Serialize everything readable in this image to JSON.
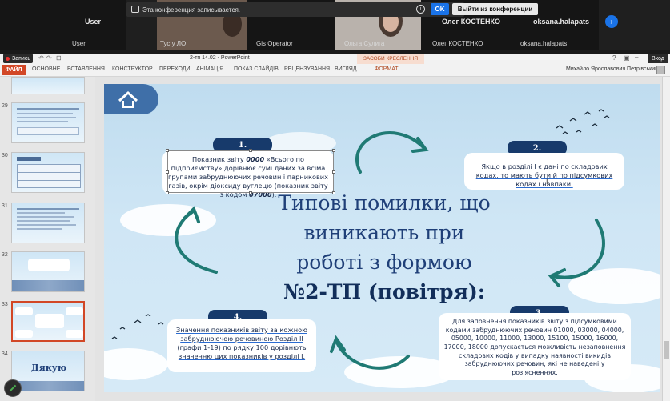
{
  "conference": {
    "recording_notice": "Эта конференция записывается.",
    "ok_label": "OK",
    "leave_label": "Выйти из конференции",
    "participants": [
      {
        "name": "User",
        "big_name": "User"
      },
      {
        "name": "Тус у ЛО"
      },
      {
        "name": "Gis Operator"
      },
      {
        "name": "Ольга Сулига"
      },
      {
        "name": "Олег КОСТЕНКО",
        "big_name": "Олег КОСТЕНКО"
      },
      {
        "name": "oksana.halapats",
        "big_name": "oksana.halapats"
      }
    ]
  },
  "powerpoint": {
    "window_title": "2-тп 14.02 - PowerPoint",
    "contextual_tab": "ЗАСОБИ КРЕСЛЕННЯ",
    "rec_label": "Запись",
    "enter_label": "Вход",
    "user_name": "Михайло Ярославович Петрівський",
    "tabs": [
      "ФАЙЛ",
      "ОСНОВНЕ",
      "ВСТАВЛЕННЯ",
      "КОНСТРУКТОР",
      "ПЕРЕХОДИ",
      "АНІМАЦІЯ",
      "ПОКАЗ СЛАЙДІВ",
      "РЕЦЕНЗУВАННЯ",
      "ВИГЛЯД",
      "ФОРМАТ"
    ],
    "thumbnails": [
      {
        "num": "29"
      },
      {
        "num": "30"
      },
      {
        "num": "31"
      },
      {
        "num": "32"
      },
      {
        "num": "33",
        "selected": true
      },
      {
        "num": "34",
        "text": "Дякую"
      }
    ]
  },
  "slide": {
    "title_lines": [
      "Типові помилки, що",
      "виникають при",
      "роботі з формою"
    ],
    "title_bold": "№2-ТП (повітря):",
    "box1": {
      "badge": "1.",
      "text_a": "Показник звіту ",
      "text_b": "0000",
      "text_c": " «Всього по підприємству» дорівнює сумі даних за всіма групами забруднюючих речовин і парникових газів, окрім діоксиду вуглецю (показник звіту з кодом ",
      "text_d": "07000",
      "text_e": ")."
    },
    "box2": {
      "badge": "2.",
      "text": "Якщо в розділі І є дані по складових кодах, то мають бути й по підсумкових кодах і навпаки."
    },
    "box3": {
      "badge": "3.",
      "text_a": "Для заповнення показників звіту з підсумковими кодами забруднюючих речовин 01000, 03000, 04000, 05000, 10000, 11000, 13000, 15100, 15000, 16000, 17000, 18000",
      "text_b": " допускається можливість незаповнення складових кодів у випадку наявності викидів забруднюючих речовин, які не наведені у роз'ясненнях."
    },
    "box4": {
      "badge": "4.",
      "text": "Значення показників звіту за кожною забруднюючою речовиною Розділ ІІ (графи 1-19) по рядку 100 дорівнють значенню цих показників у розділі І."
    }
  },
  "colors": {
    "accent": "#1a73e8",
    "file_tab": "#d24726",
    "badge": "#173a6b",
    "arrow": "#1f7a74",
    "title": "#1f3f78"
  }
}
